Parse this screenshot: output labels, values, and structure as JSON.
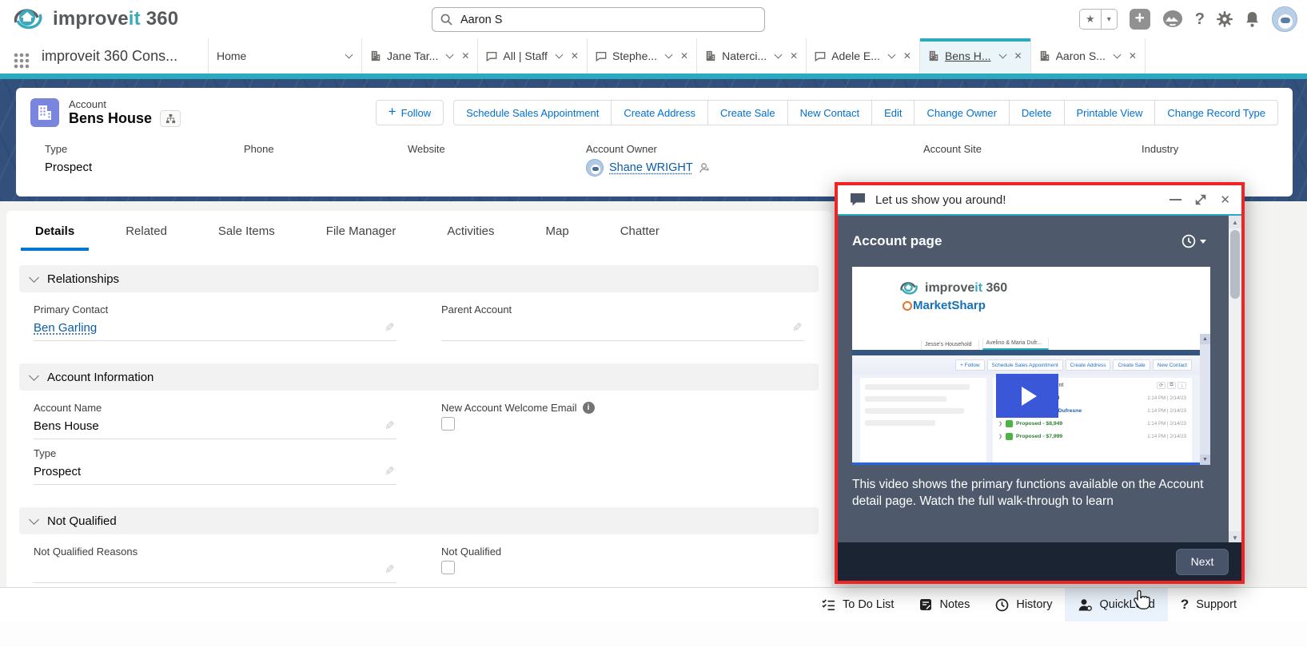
{
  "topbar": {
    "logo_improve": "improve",
    "logo_it": "it",
    "logo_360": "360",
    "search_value": "Aaron S"
  },
  "nav": {
    "app_name": "improveit 360 Cons...",
    "tabs": [
      {
        "label": "Home"
      },
      {
        "label": "Jane Tar..."
      },
      {
        "label": "All | Staff"
      },
      {
        "label": "Stephe..."
      },
      {
        "label": "Naterci..."
      },
      {
        "label": "Adele E..."
      },
      {
        "label": "Bens H..."
      },
      {
        "label": "Aaron S..."
      }
    ]
  },
  "record": {
    "entity": "Account",
    "title": "Bens House",
    "follow_label": "Follow",
    "actions": [
      "Schedule Sales Appointment",
      "Create Address",
      "Create Sale",
      "New Contact",
      "Edit",
      "Change Owner",
      "Delete",
      "Printable View",
      "Change Record Type"
    ],
    "fields": [
      {
        "label": "Type",
        "value": "Prospect"
      },
      {
        "label": "Phone",
        "value": ""
      },
      {
        "label": "Website",
        "value": ""
      },
      {
        "label": "Account Owner",
        "value": "Shane WRIGHT"
      },
      {
        "label": "Account Site",
        "value": ""
      },
      {
        "label": "Industry",
        "value": ""
      }
    ]
  },
  "detail": {
    "tabs": [
      "Details",
      "Related",
      "Sale Items",
      "File Manager",
      "Activities",
      "Map",
      "Chatter"
    ],
    "sections": {
      "relationships": {
        "title": "Relationships",
        "primary_contact_label": "Primary Contact",
        "primary_contact_value": "Ben Garling",
        "parent_account_label": "Parent Account"
      },
      "account_information": {
        "title": "Account Information",
        "account_name_label": "Account Name",
        "account_name_value": "Bens House",
        "welcome_email_label": "New Account Welcome Email",
        "type_label": "Type",
        "type_value": "Prospect"
      },
      "not_qualified": {
        "title": "Not Qualified",
        "reasons_label": "Not Qualified Reasons",
        "not_qualified_label": "Not Qualified"
      }
    }
  },
  "walkthrough": {
    "title": "Let us show you around!",
    "heading": "Account page",
    "description": "This video shows the primary functions available on the Account detail page. Watch the full walk-through to learn",
    "next_label": "Next",
    "video": {
      "brand_improve": "improve",
      "brand_it": "it",
      "brand_360": "360",
      "brand_marketsharp": "MarketSharp",
      "mini_tab1": "Jesse's Household",
      "mini_tab2": "Avelino & Maria Dufr...",
      "mini_buttons": [
        "+ Follow",
        "Schedule Sales Appointment",
        "Create Address",
        "Create Sale",
        "New Contact"
      ],
      "panel_title": "& Maria Dufresne Account",
      "timeline": [
        {
          "label": "Account Created",
          "time": "1:14 PM | 2/14/23"
        },
        {
          "label": "Avelino & Maria Dufresne",
          "time": "1:14 PM | 2/14/23"
        },
        {
          "label": "Proposed - $8,949",
          "time": "1:14 PM | 2/14/23"
        },
        {
          "label": "Proposed - $7,999",
          "time": "1:14 PM | 2/14/23"
        }
      ]
    }
  },
  "utility_bar": {
    "items": [
      "To Do List",
      "Notes",
      "History",
      "QuickLead",
      "Support"
    ]
  },
  "colors": {
    "accent_teal": "#2ba9c0",
    "navy_band": "#32507b",
    "highlight_red": "#ee2524",
    "panel_slate": "#4e5a6b",
    "panel_footer": "#1b2432",
    "link_blue": "#0b5cab",
    "action_blue": "#0070d2",
    "active_tab_underline": "#0176d3",
    "play_blue": "#3a57d8"
  }
}
